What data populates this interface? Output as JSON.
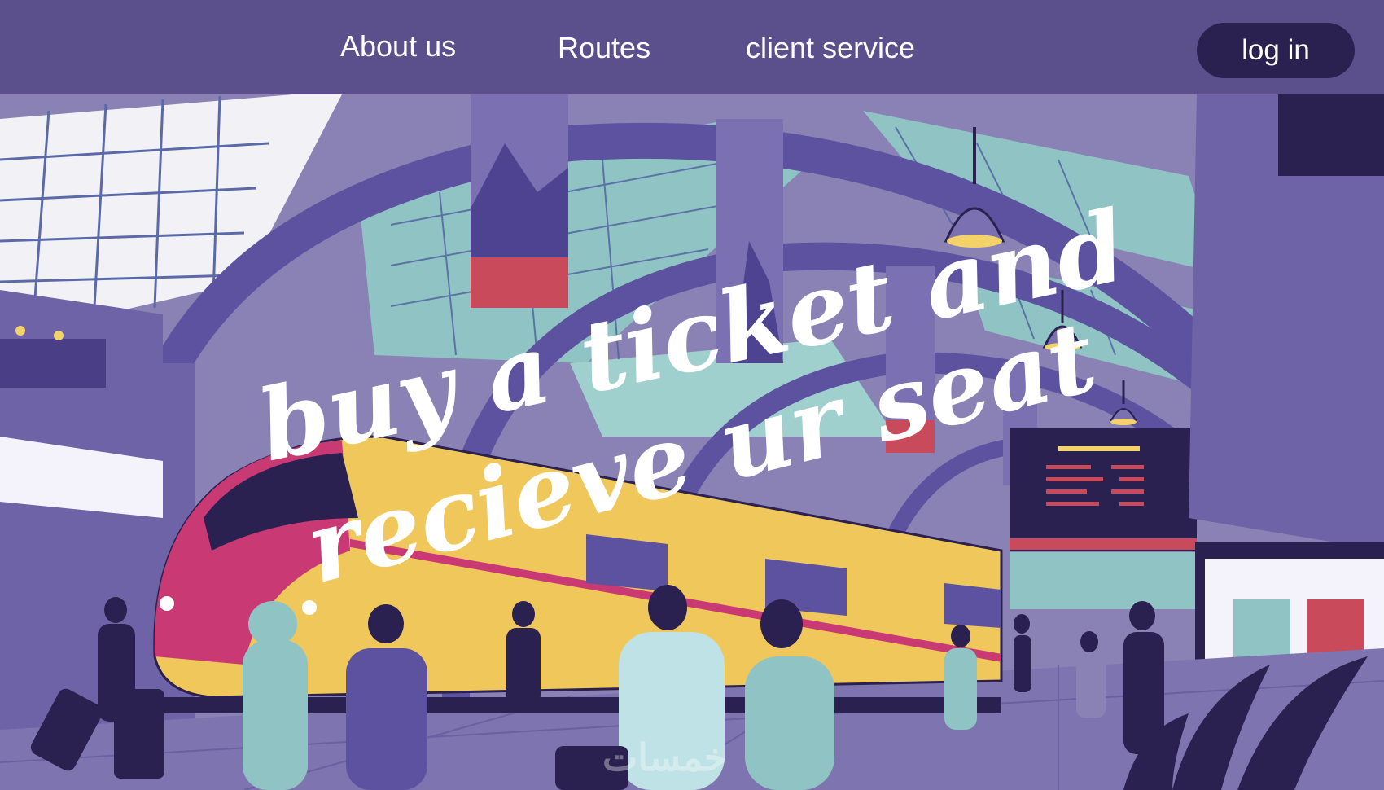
{
  "nav": {
    "items": [
      "About us",
      "Routes",
      "client service"
    ],
    "login_label": "log in"
  },
  "hero": {
    "headline_line1": "buy a ticket and",
    "headline_line2": "recieve ur seat",
    "watermark": "خمسات"
  },
  "colors": {
    "navbar": "#5b508c",
    "login_button": "#2a2150",
    "train_yellow": "#efc75a",
    "train_pink": "#c93a74",
    "roof_glass": "#8fc3c4"
  },
  "icons": [
    "hanging-lamp-icon",
    "suitcase-icon",
    "plant-icon"
  ]
}
